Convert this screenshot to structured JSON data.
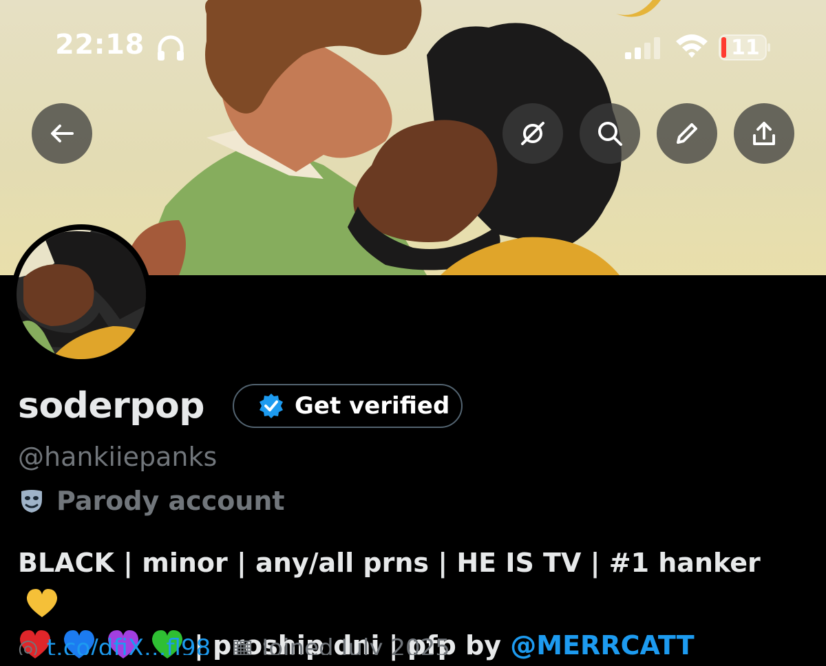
{
  "status_bar": {
    "time": "22:18",
    "battery": "11"
  },
  "header_buttons": [
    {
      "name": "back",
      "icon": "arrow-left-icon"
    },
    {
      "name": "grok",
      "icon": "grok-icon"
    },
    {
      "name": "search",
      "icon": "search-icon"
    },
    {
      "name": "edit",
      "icon": "pencil-icon"
    },
    {
      "name": "share",
      "icon": "share-icon"
    }
  ],
  "profile": {
    "display_name": "soderpop",
    "get_verified_label": "Get verified",
    "handle": "@hankiiepanks",
    "parody_label": "Parody account",
    "bio_line1": "BLACK | minor | any/all prns | HE IS TV | #1 hanker",
    "bio_line2_text": "| proship dni | pfp by",
    "bio_mention": "@MERRCATT",
    "link_partial": "t.co/dfiX...fl98",
    "joined_partial": "Joined July 2025"
  },
  "colors": {
    "accent": "#1d9bf0",
    "muted": "#71767b",
    "text": "#e7e9ea",
    "background": "#000000"
  }
}
